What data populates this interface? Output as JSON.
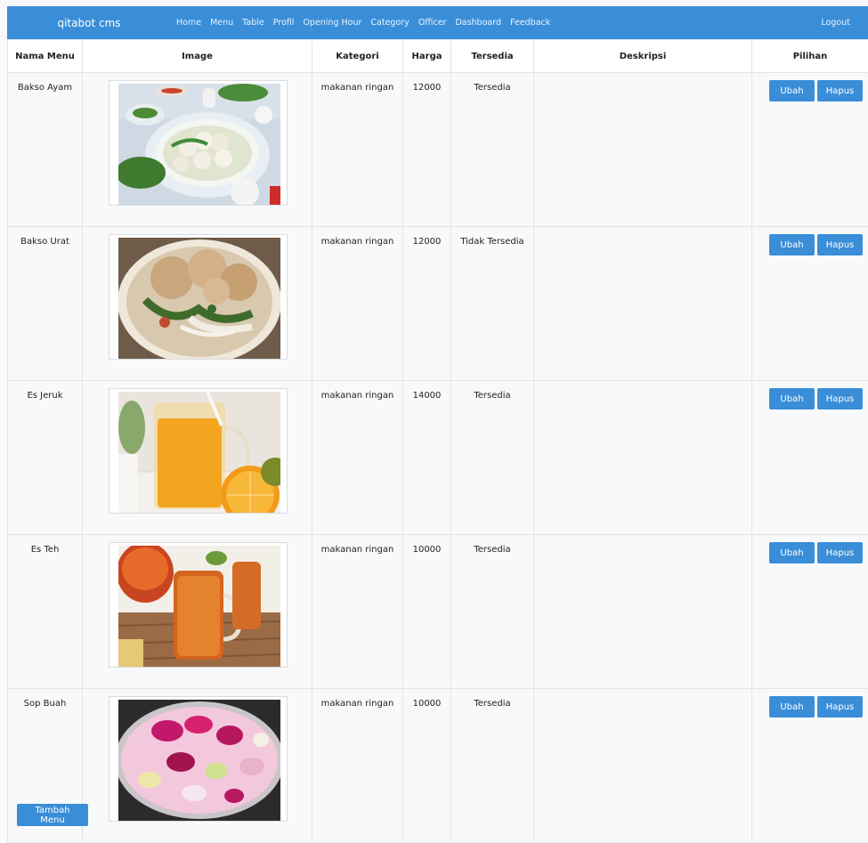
{
  "navbar": {
    "brand": "qitabot cms",
    "links": [
      "Home",
      "Menu",
      "Table",
      "Profil",
      "Opening Hour",
      "Category",
      "Officer",
      "Dashboard",
      "Feedback"
    ],
    "logout": "Logout"
  },
  "table": {
    "headers": [
      "Nama Menu",
      "Image",
      "Kategori",
      "Harga",
      "Tersedia",
      "Deskripsi",
      "Pilihan"
    ],
    "rows": [
      {
        "name": "Bakso Ayam",
        "category": "makanan ringan",
        "price": "12000",
        "available": "Tersedia",
        "description": "",
        "image": "bakso-ayam-photo"
      },
      {
        "name": "Bakso Urat",
        "category": "makanan ringan",
        "price": "12000",
        "available": "Tidak Tersedia",
        "description": "",
        "image": "bakso-urat-photo"
      },
      {
        "name": "Es Jeruk",
        "category": "makanan ringan",
        "price": "14000",
        "available": "Tersedia",
        "description": "",
        "image": "es-jeruk-photo"
      },
      {
        "name": "Es Teh",
        "category": "makanan ringan",
        "price": "10000",
        "available": "Tersedia",
        "description": "",
        "image": "es-teh-photo"
      },
      {
        "name": "Sop Buah",
        "category": "makanan ringan",
        "price": "10000",
        "available": "Tersedia",
        "description": "",
        "image": "sop-buah-photo"
      }
    ],
    "edit_label": "Ubah",
    "delete_label": "Hapus"
  },
  "add_button_label": "Tambah Menu",
  "colors": {
    "primary": "#3a8ed8",
    "background": "#f8f9fb"
  }
}
